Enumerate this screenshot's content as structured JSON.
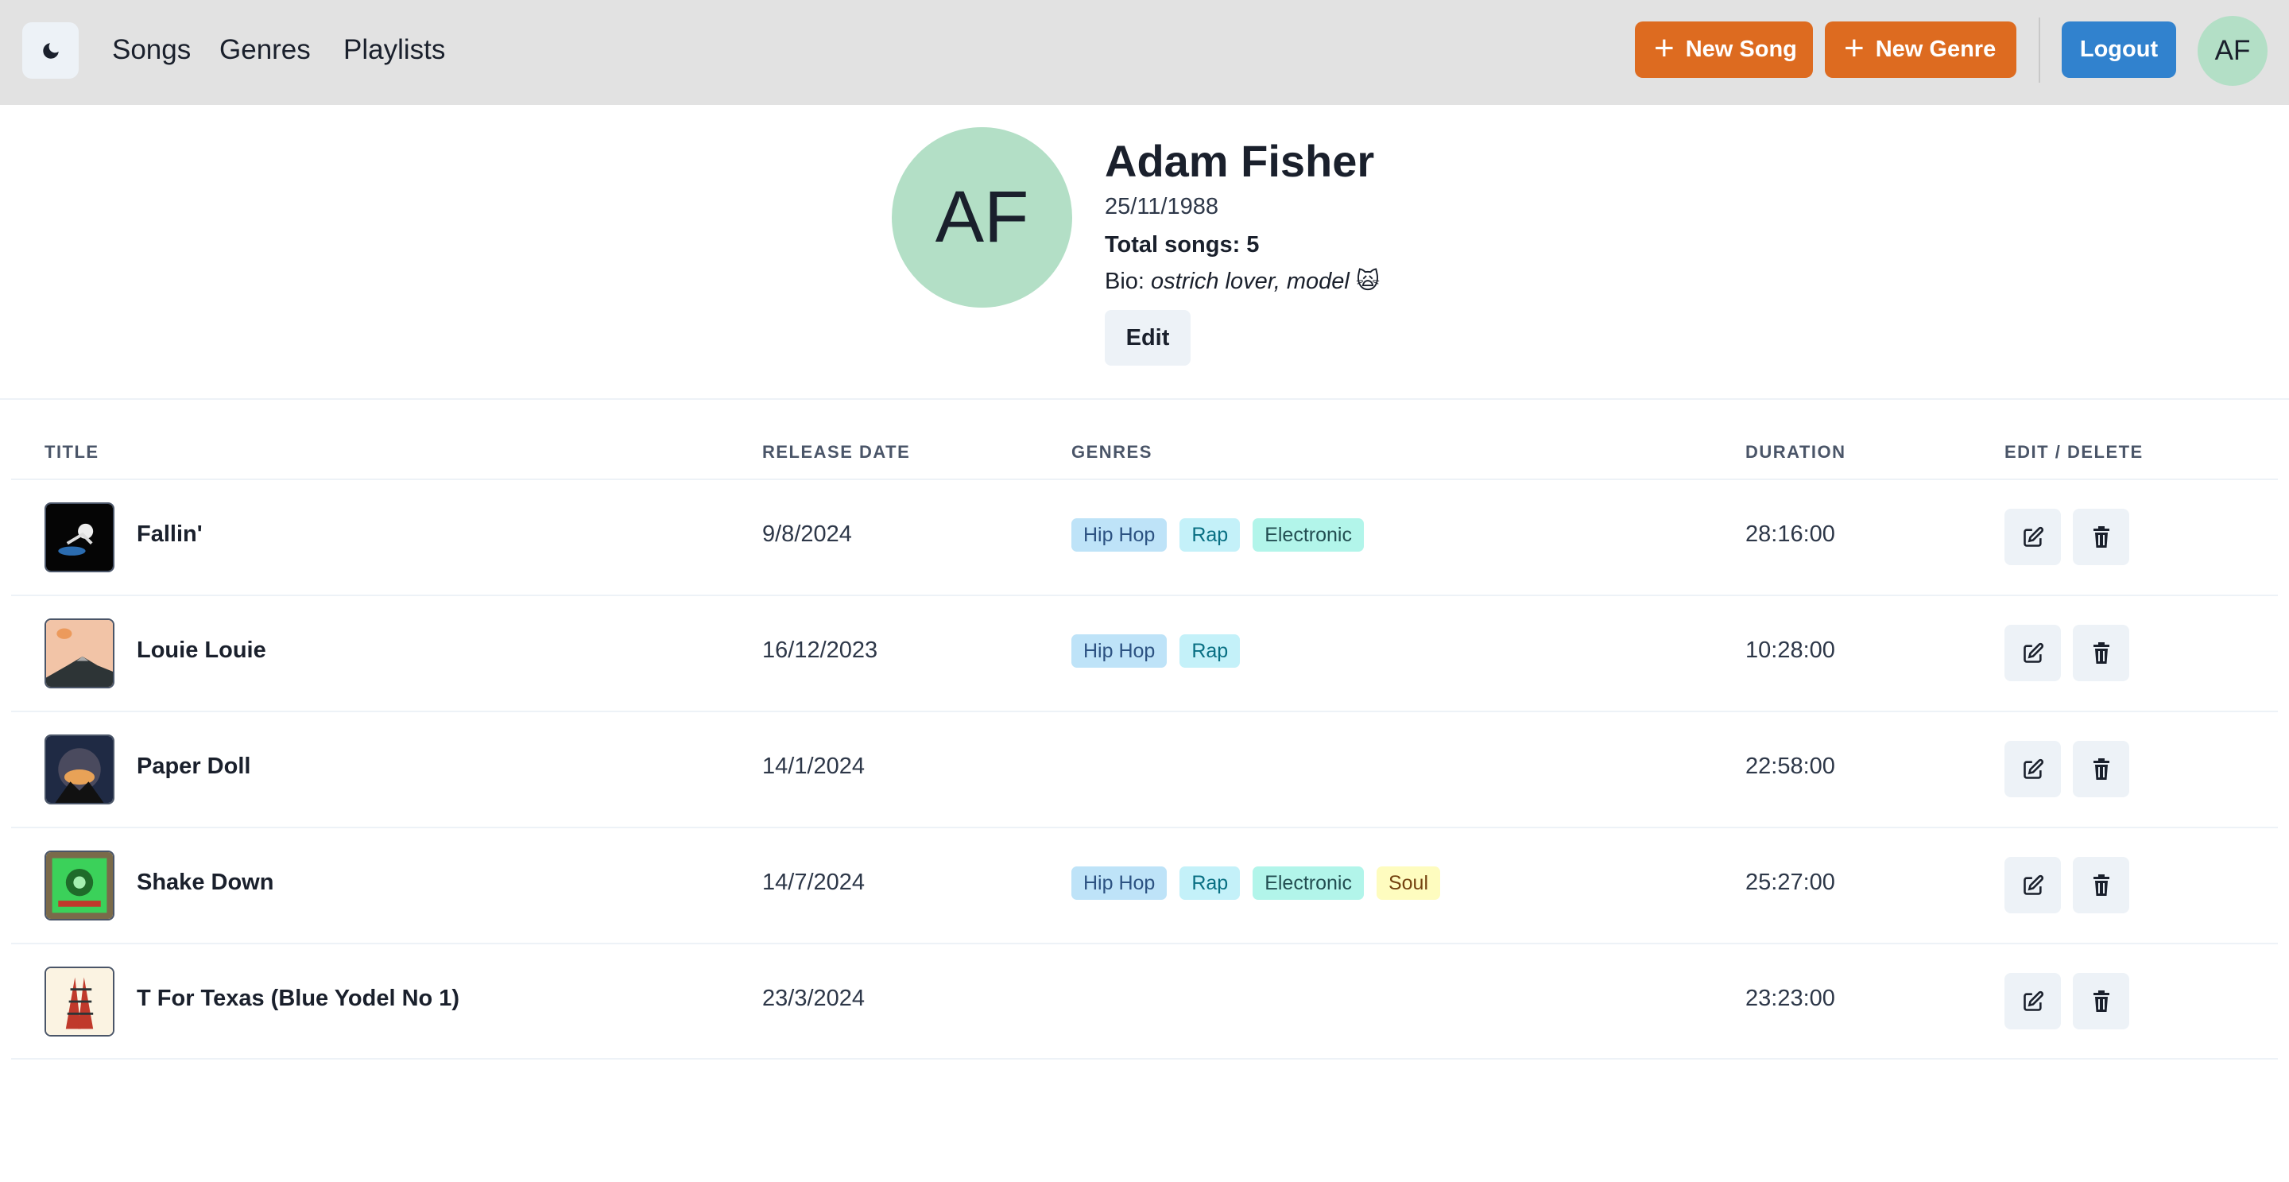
{
  "nav": {
    "links": [
      "Songs",
      "Genres",
      "Playlists"
    ],
    "new_song_label": "New Song",
    "new_genre_label": "New Genre",
    "logout_label": "Logout",
    "user_initials": "AF"
  },
  "profile": {
    "initials": "AF",
    "name": "Adam Fisher",
    "dob": "25/11/1988",
    "total_songs": "Total songs: 5",
    "bio_label": "Bio: ",
    "bio_text": "ostrich lover, model 🙀",
    "edit_label": "Edit"
  },
  "table": {
    "headers": [
      "TITLE",
      "RELEASE DATE",
      "GENRES",
      "DURATION",
      "EDIT / DELETE"
    ],
    "rows": [
      {
        "title": "Fallin'",
        "release_date": "9/8/2024",
        "genres": [
          "Hip Hop",
          "Rap",
          "Electronic"
        ],
        "duration": "28:16:00"
      },
      {
        "title": "Louie Louie",
        "release_date": "16/12/2023",
        "genres": [
          "Hip Hop",
          "Rap"
        ],
        "duration": "10:28:00"
      },
      {
        "title": "Paper Doll",
        "release_date": "14/1/2024",
        "genres": [],
        "duration": "22:58:00"
      },
      {
        "title": "Shake Down",
        "release_date": "14/7/2024",
        "genres": [
          "Hip Hop",
          "Rap",
          "Electronic",
          "Soul"
        ],
        "duration": "25:27:00"
      },
      {
        "title": "T For Texas (Blue Yodel No 1)",
        "release_date": "23/3/2024",
        "genres": [],
        "duration": "23:23:00"
      }
    ]
  },
  "colors": {
    "header_bg": "#e2e2e2",
    "accent_orange": "#dd6b20",
    "accent_blue": "#3182ce",
    "avatar_bg": "#b3dfc6"
  },
  "icons": [
    "moon-icon",
    "plus-icon",
    "edit-icon",
    "trash-icon"
  ]
}
